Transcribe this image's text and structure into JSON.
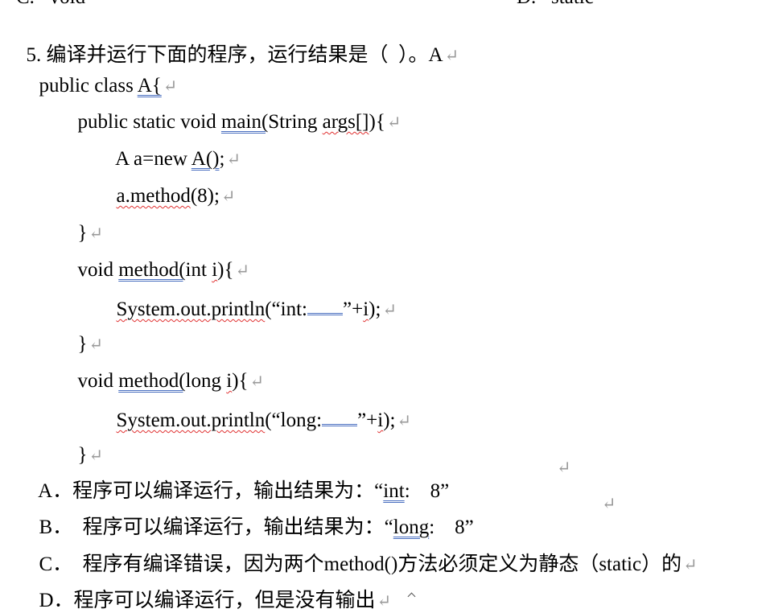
{
  "top_fragment": {
    "left": "C.   void",
    "right": "D.   static"
  },
  "question": {
    "text": "5. 编译并运行下面的程序，运行结果是（  ）。A"
  },
  "code": {
    "l1_a": "public class ",
    "l1_b": "A{",
    "l2_a": "public static void ",
    "l2_b": "main(",
    "l2_c": "String ",
    "l2_d": "args[]",
    "l2_e": "){",
    "l3_a": "A a=new ",
    "l3_b": "A()",
    "l3_c": ";",
    "l4_a": "a.method",
    "l4_b": "(8);",
    "l5": "}",
    "l6_a": "void ",
    "l6_b": "method(",
    "l6_c": "int ",
    "l6_d": "i",
    "l6_e": "){",
    "l7_a": "System.out.println",
    "l7_b": "(“int:",
    "l7_c": "”+",
    "l7_d": "i",
    "l7_e": ");",
    "l8": "}",
    "l9_a": "void ",
    "l9_b": "method(",
    "l9_c": "long ",
    "l9_d": "i",
    "l9_e": "){",
    "l10_a": "System.out.println",
    "l10_b": "(“long:",
    "l10_c": "”+",
    "l10_d": "i",
    "l10_e": ");",
    "l11": "}"
  },
  "options": {
    "a_pre": "A．程序可以编译运行，输出结果为：“",
    "a_word": "int",
    "a_post": ":    8”",
    "b_pre": "B．  程序可以编译运行，输出结果为：“",
    "b_word": "long",
    "b_post": ":    8”",
    "c": "C．  程序有编译错误，因为两个method()方法必须定义为静态（static）的",
    "d": "D．程序可以编译运行，但是没有输出"
  },
  "marks": {
    "return": "↵"
  }
}
